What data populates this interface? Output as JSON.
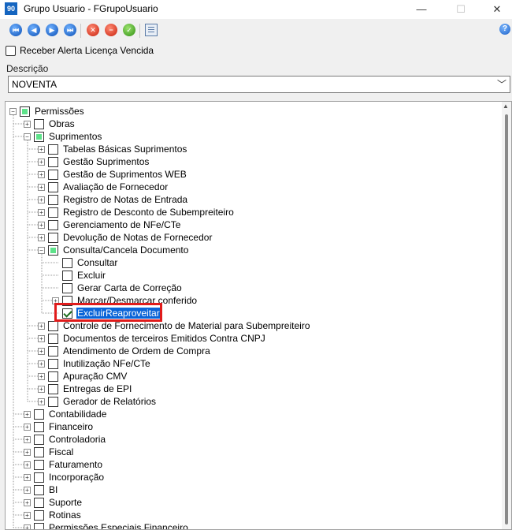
{
  "window": {
    "title": "Grupo Usuario - FGrupoUsuario",
    "app_icon": "90",
    "minimize": "—",
    "maximize": "☐",
    "close": "✕"
  },
  "toolbar": {
    "first_icon": "first-record-icon",
    "prev_icon": "previous-record-icon",
    "next_icon": "next-record-icon",
    "last_icon": "last-record-icon",
    "cancel_icon": "cancel-icon",
    "delete_icon": "delete-icon",
    "confirm_icon": "confirm-icon",
    "report_icon": "report-icon",
    "help_icon": "help-icon"
  },
  "form": {
    "alert_label": "Receber Alerta Licença Vencida",
    "alert_checked": false,
    "descricao_label": "Descrição",
    "descricao_value": "NOVENTA"
  },
  "tree": [
    {
      "label": "Permissões",
      "level": 0,
      "expander": "-",
      "state": "partial"
    },
    {
      "label": "Obras",
      "level": 1,
      "expander": "+",
      "state": "empty"
    },
    {
      "label": "Suprimentos",
      "level": 1,
      "expander": "-",
      "state": "partial"
    },
    {
      "label": "Tabelas Básicas Suprimentos",
      "level": 2,
      "expander": "+",
      "state": "empty"
    },
    {
      "label": "Gestão Suprimentos",
      "level": 2,
      "expander": "+",
      "state": "empty"
    },
    {
      "label": "Gestão de Suprimentos WEB",
      "level": 2,
      "expander": "+",
      "state": "empty"
    },
    {
      "label": "Avaliação de Fornecedor",
      "level": 2,
      "expander": "+",
      "state": "empty"
    },
    {
      "label": "Registro de Notas de Entrada",
      "level": 2,
      "expander": "+",
      "state": "empty"
    },
    {
      "label": "Registro de Desconto de Subempreiteiro",
      "level": 2,
      "expander": "+",
      "state": "empty"
    },
    {
      "label": "Gerenciamento de NFe/CTe",
      "level": 2,
      "expander": "+",
      "state": "empty"
    },
    {
      "label": "Devolução de Notas de Fornecedor",
      "level": 2,
      "expander": "+",
      "state": "empty"
    },
    {
      "label": "Consulta/Cancela Documento",
      "level": 2,
      "expander": "-",
      "state": "partial"
    },
    {
      "label": "Consultar",
      "level": 3,
      "expander": "",
      "state": "empty"
    },
    {
      "label": "Excluir",
      "level": 3,
      "expander": "",
      "state": "empty"
    },
    {
      "label": "Gerar Carta de Correção",
      "level": 3,
      "expander": "",
      "state": "empty"
    },
    {
      "label": "Marcar/Desmarcar conferido",
      "level": 3,
      "expander": "+",
      "state": "empty"
    },
    {
      "label": "ExcluirReaproveitar",
      "level": 3,
      "expander": "",
      "state": "checked",
      "selected": true
    },
    {
      "label": "Controle de Fornecimento de Material para Subempreiteiro",
      "level": 2,
      "expander": "+",
      "state": "empty"
    },
    {
      "label": "Documentos de terceiros Emitidos Contra CNPJ",
      "level": 2,
      "expander": "+",
      "state": "empty"
    },
    {
      "label": "Atendimento de Ordem de Compra",
      "level": 2,
      "expander": "+",
      "state": "empty"
    },
    {
      "label": "Inutilização NFe/CTe",
      "level": 2,
      "expander": "+",
      "state": "empty"
    },
    {
      "label": "Apuração CMV",
      "level": 2,
      "expander": "+",
      "state": "empty"
    },
    {
      "label": "Entregas de EPI",
      "level": 2,
      "expander": "+",
      "state": "empty"
    },
    {
      "label": "Gerador de Relatórios",
      "level": 2,
      "expander": "+",
      "state": "empty"
    },
    {
      "label": "Contabilidade",
      "level": 1,
      "expander": "+",
      "state": "empty"
    },
    {
      "label": "Financeiro",
      "level": 1,
      "expander": "+",
      "state": "empty"
    },
    {
      "label": "Controladoria",
      "level": 1,
      "expander": "+",
      "state": "empty"
    },
    {
      "label": "Fiscal",
      "level": 1,
      "expander": "+",
      "state": "empty"
    },
    {
      "label": "Faturamento",
      "level": 1,
      "expander": "+",
      "state": "empty"
    },
    {
      "label": "Incorporação",
      "level": 1,
      "expander": "+",
      "state": "empty"
    },
    {
      "label": "BI",
      "level": 1,
      "expander": "+",
      "state": "empty"
    },
    {
      "label": "Suporte",
      "level": 1,
      "expander": "+",
      "state": "empty"
    },
    {
      "label": "Rotinas",
      "level": 1,
      "expander": "+",
      "state": "empty"
    },
    {
      "label": "Permissões Especiais Financeiro",
      "level": 1,
      "expander": "+",
      "state": "empty"
    }
  ],
  "colors": {
    "selection": "#0a64d8",
    "highlight_border": "#e01b1b",
    "partial_fill": "#5ee28a"
  }
}
